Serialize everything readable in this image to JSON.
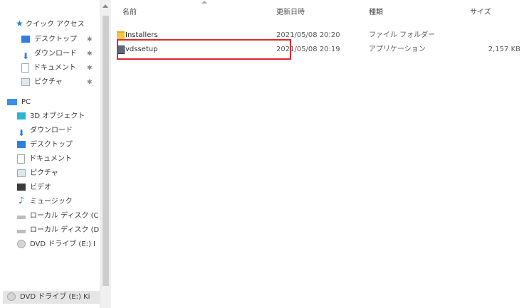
{
  "sidebar": {
    "quick_access": "クイック アクセス",
    "quick_items": [
      {
        "label": "デスクトップ"
      },
      {
        "label": "ダウンロード"
      },
      {
        "label": "ドキュメント"
      },
      {
        "label": "ピクチャ"
      }
    ],
    "pc_label": "PC",
    "pc_items": [
      {
        "label": "3D オブジェクト"
      },
      {
        "label": "ダウンロード"
      },
      {
        "label": "デスクトップ"
      },
      {
        "label": "ドキュメント"
      },
      {
        "label": "ピクチャ"
      },
      {
        "label": "ビデオ"
      },
      {
        "label": "ミュージック"
      },
      {
        "label": "ローカル ディスク (C"
      },
      {
        "label": "ローカル ディスク (D"
      },
      {
        "label": "DVD ドライブ (E:) I"
      }
    ],
    "selected_item": "DVD ドライブ (E:) Ki"
  },
  "columns": {
    "name": "名前",
    "date": "更新日時",
    "type": "種類",
    "size": "サイズ"
  },
  "files": [
    {
      "name": "Installers",
      "date": "2021/05/08 20:20",
      "type": "ファイル フォルダー",
      "size": ""
    },
    {
      "name": "vdssetup",
      "date": "2021/05/08 20:19",
      "type": "アプリケーション",
      "size": "2,157 KB"
    }
  ],
  "colors": {
    "highlight_border": "#e0262b",
    "selected_bg": "#e5e5e5"
  }
}
